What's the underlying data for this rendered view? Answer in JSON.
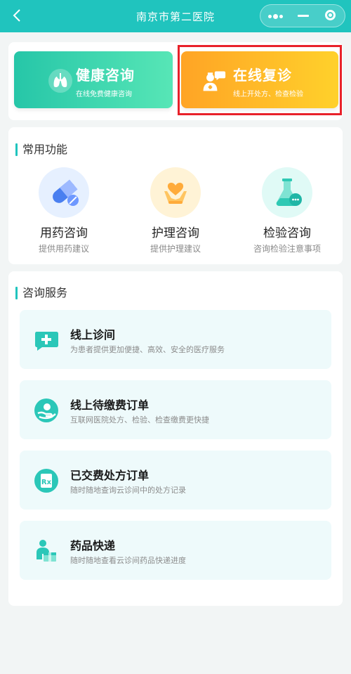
{
  "nav": {
    "title": "南京市第二医院",
    "back_icon": "back-chevron-icon",
    "menu_icon": "more-dots-icon",
    "minimize_icon": "minimize-icon",
    "close_icon": "target-close-icon"
  },
  "banners": [
    {
      "title": "健康咨询",
      "subtitle": "在线免费健康咨询",
      "icon": "lungs-icon",
      "color_from": "#26c6a8",
      "color_to": "#57e6b6"
    },
    {
      "title": "在线复诊",
      "subtitle": "线上开处方、检查检验",
      "icon": "doctor-chat-icon",
      "color_from": "#ffa425",
      "color_to": "#ffd12b"
    }
  ],
  "highlight_color": "#e8212a",
  "common": {
    "title": "常用功能",
    "items": [
      {
        "label": "用药咨询",
        "sub": "提供用药建议",
        "icon": "pill-icon",
        "bg": "#e6f0ff"
      },
      {
        "label": "护理咨询",
        "sub": "提供护理建议",
        "icon": "heart-hands-icon",
        "bg": "#fff3d6"
      },
      {
        "label": "检验咨询",
        "sub": "咨询检验注意事项",
        "icon": "flask-icon",
        "bg": "#e0faf6"
      }
    ]
  },
  "services": {
    "title": "咨询服务",
    "items": [
      {
        "title": "线上诊间",
        "sub": "为患者提供更加便捷、高效、安全的医疗服务",
        "icon": "medical-chat-icon"
      },
      {
        "title": "线上待缴费订单",
        "sub": "互联网医院处方、检验、检查缴费更快捷",
        "icon": "payment-hand-icon"
      },
      {
        "title": "已交费处方订单",
        "sub": "随时随地查询云诊间中的处方记录",
        "icon": "prescription-icon"
      },
      {
        "title": "药品快递",
        "sub": "随时随地查看云诊间药品快递进度",
        "icon": "delivery-icon"
      }
    ]
  },
  "accent_color": "#20c4be"
}
